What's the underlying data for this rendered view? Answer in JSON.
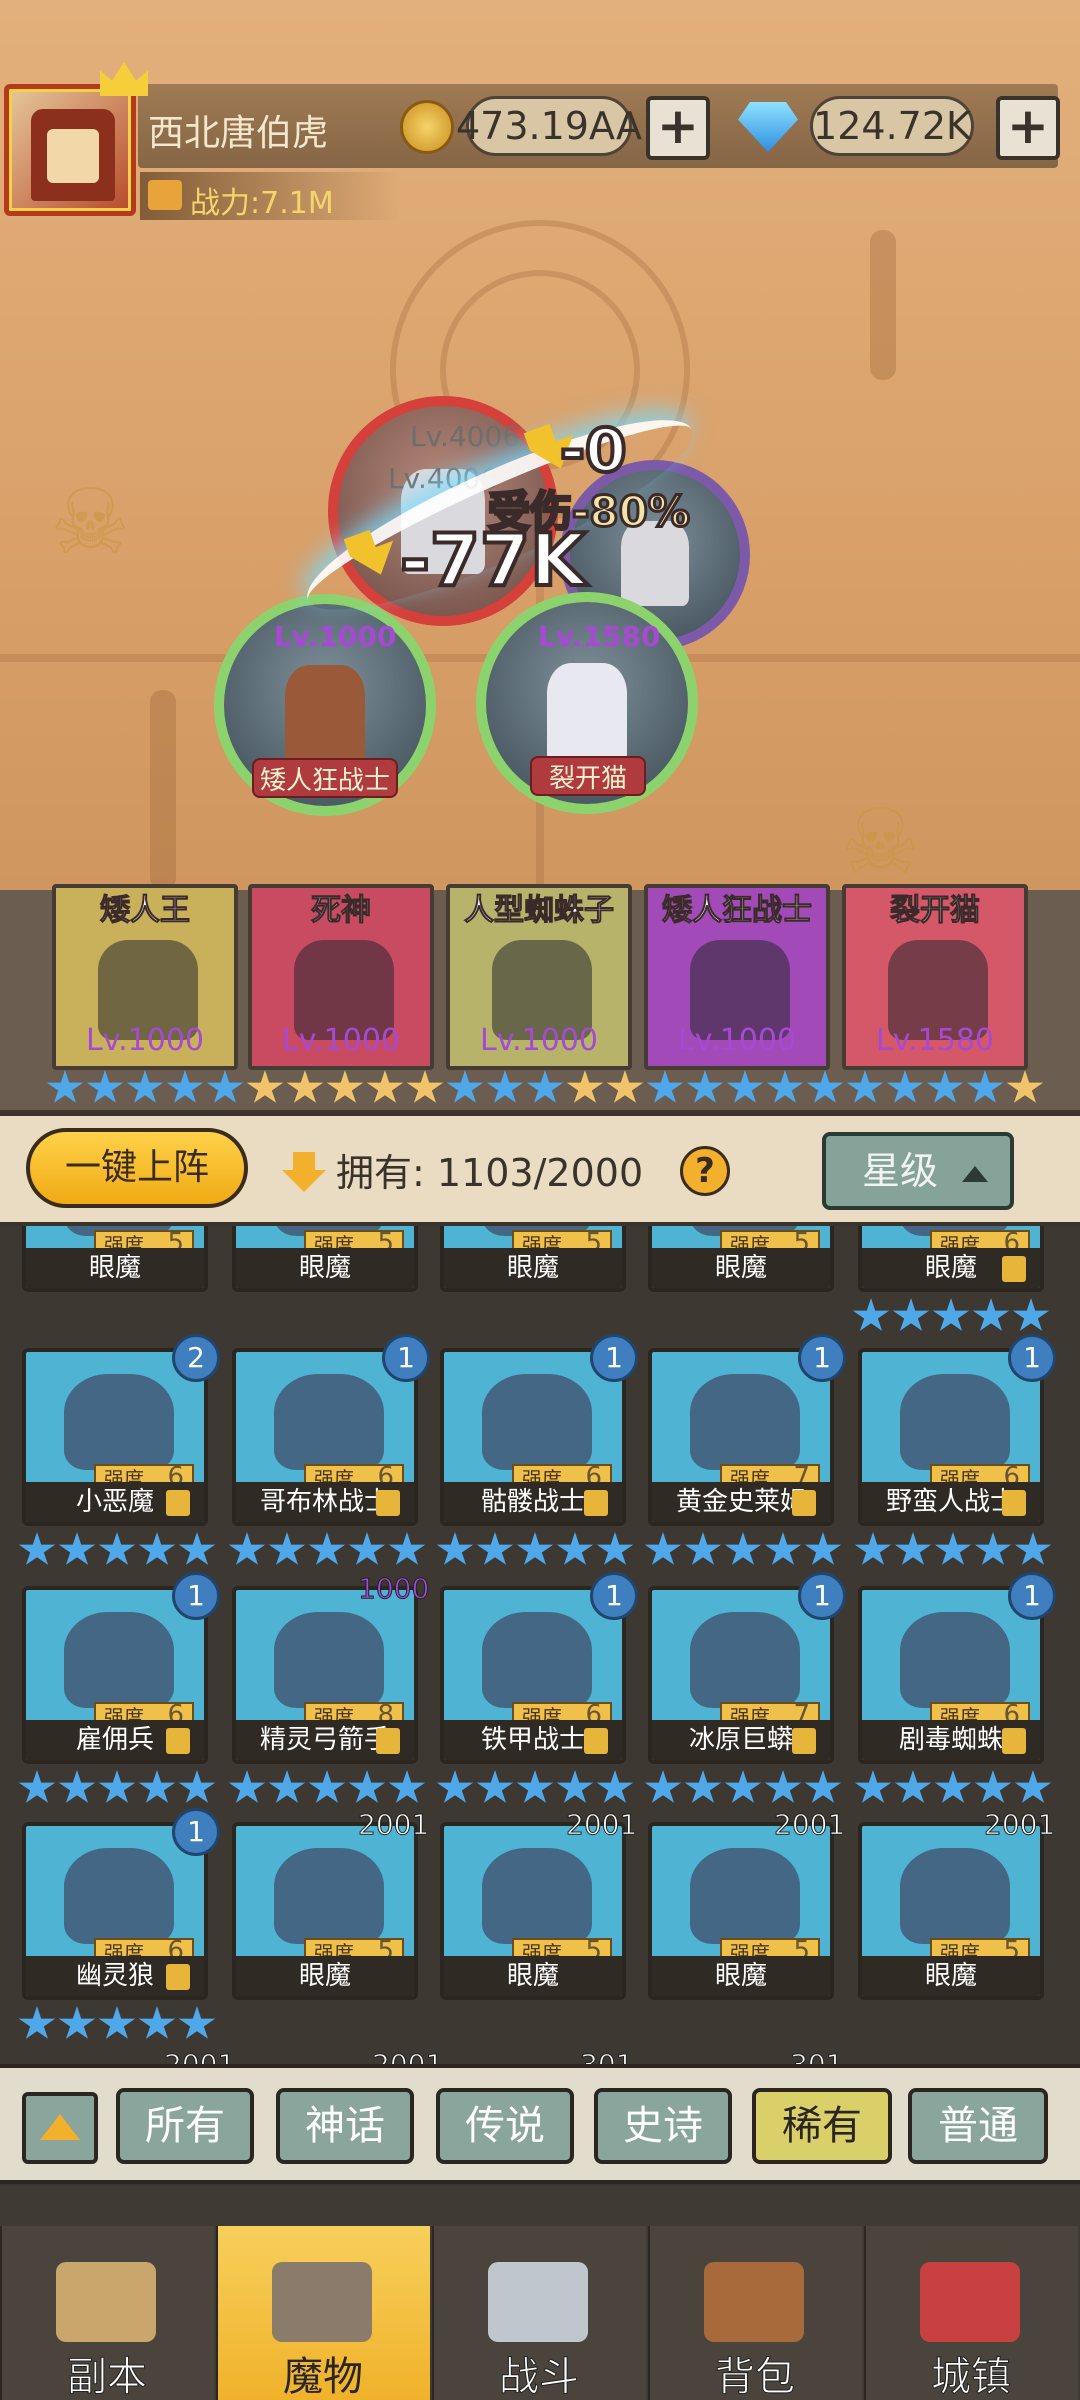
{
  "header": {
    "player_name": "西北唐伯虎",
    "power": "战力:7.1M",
    "coins": "473.19AA",
    "gems": "124.72K",
    "plus": "+"
  },
  "battle": {
    "units": [
      {
        "level": "Lv.1000",
        "name": "矮人狂战士"
      },
      {
        "level": "Lv.1580",
        "name": "裂开猫"
      },
      {
        "level": "Lv.4006"
      },
      {
        "level": "Lv.4006"
      }
    ],
    "damage_big": "-77K",
    "damage_small": "-0",
    "damage_label": "受伤-80%"
  },
  "team": [
    {
      "name": "矮人王",
      "level": "Lv.1000",
      "color": "#c8b15a"
    },
    {
      "name": "死神",
      "level": "Lv.1000",
      "color": "#c94b62"
    },
    {
      "name": "人型蜘蛛子",
      "level": "Lv.1000",
      "color": "#b8b36a"
    },
    {
      "name": "矮人狂战士",
      "level": "Lv.1000",
      "color": "#a24ab8"
    },
    {
      "name": "裂开猫",
      "level": "Lv.1580",
      "color": "#d45868"
    }
  ],
  "controls": {
    "deploy": "一键上阵",
    "own_label": "拥有:",
    "own_value": "1103/2000",
    "help": "?",
    "sort": "星级"
  },
  "grid": {
    "strength_label": "强度",
    "top_partial": [
      {
        "name": "眼魔",
        "strength": "5"
      },
      {
        "name": "眼魔",
        "strength": "5"
      },
      {
        "name": "眼魔",
        "strength": "5"
      },
      {
        "name": "眼魔",
        "strength": "5"
      },
      {
        "name": "眼魔",
        "strength": "6"
      }
    ],
    "row1": [
      {
        "name": "小恶魔",
        "strength": "6",
        "badge": "2"
      },
      {
        "name": "哥布林战士",
        "strength": "6",
        "badge": "1"
      },
      {
        "name": "骷髅战士",
        "strength": "6",
        "badge": "1"
      },
      {
        "name": "黄金史莱姆",
        "strength": "7",
        "badge": "1"
      },
      {
        "name": "野蛮人战士",
        "strength": "6",
        "badge": "1"
      }
    ],
    "row2": [
      {
        "name": "雇佣兵",
        "strength": "6",
        "badge": "1"
      },
      {
        "name": "精灵弓箭手",
        "strength": "8",
        "badge": "1000"
      },
      {
        "name": "铁甲战士",
        "strength": "6",
        "badge": "1"
      },
      {
        "name": "冰原巨蟒",
        "strength": "7",
        "badge": "1"
      },
      {
        "name": "剧毒蜘蛛",
        "strength": "6",
        "badge": "1"
      }
    ],
    "row3": [
      {
        "name": "幽灵狼",
        "strength": "6",
        "badge": "1"
      },
      {
        "name": "眼魔",
        "strength": "5",
        "badge": "2001"
      },
      {
        "name": "眼魔",
        "strength": "5",
        "badge": "2001"
      },
      {
        "name": "眼魔",
        "strength": "5",
        "badge": "2001"
      },
      {
        "name": "眼魔",
        "strength": "5",
        "badge": "2001"
      }
    ],
    "bottom_counts": [
      "2001",
      "2001",
      "301",
      "301"
    ]
  },
  "filters": [
    "所有",
    "神话",
    "传说",
    "史诗",
    "稀有",
    "普通"
  ],
  "nav": [
    "副本",
    "魔物",
    "战斗",
    "背包",
    "城镇"
  ],
  "colors": {
    "card_blue": "#4fb3d4",
    "accent_gold": "#f2b02c",
    "star_blue": "#4fa8ea",
    "star_gold": "#f2c46a"
  }
}
